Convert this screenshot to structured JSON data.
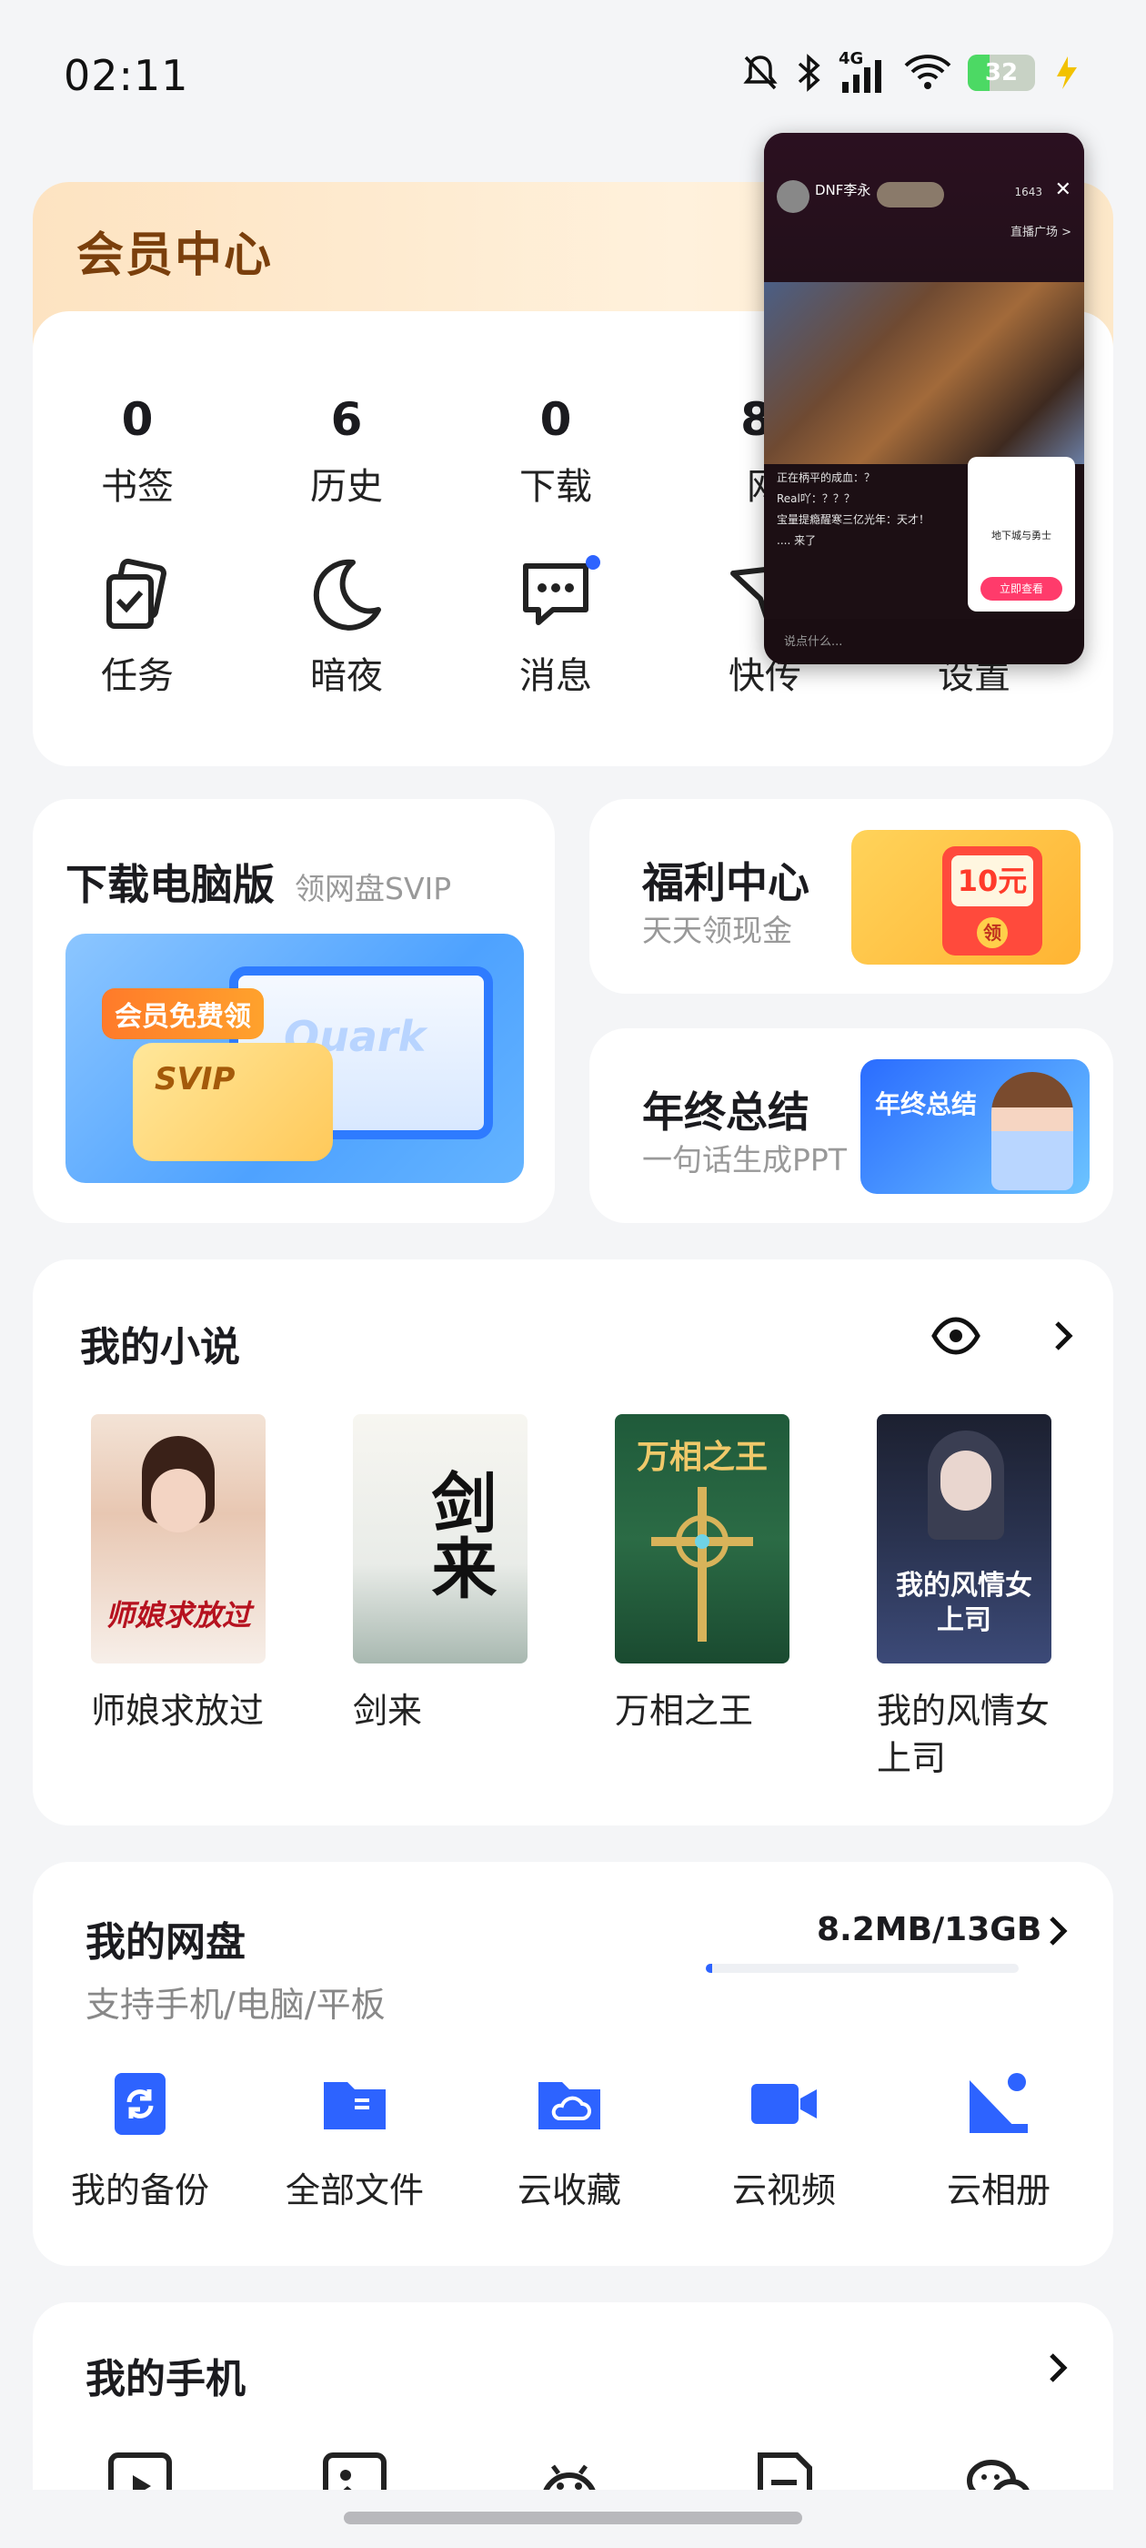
{
  "status_bar": {
    "time": "02:11",
    "network": "4G",
    "battery": "32",
    "battery_level": 0.32
  },
  "member": {
    "title": "会员中心",
    "stats": [
      {
        "value": "0",
        "label": "书签"
      },
      {
        "value": "6",
        "label": "历史"
      },
      {
        "value": "0",
        "label": "下载"
      },
      {
        "value": "8.",
        "label": "网"
      }
    ],
    "tools": [
      {
        "label": "任务",
        "icon": "task-icon"
      },
      {
        "label": "暗夜",
        "icon": "moon-icon"
      },
      {
        "label": "消息",
        "icon": "message-icon"
      },
      {
        "label": "快传",
        "icon": "send-icon"
      },
      {
        "label": "设置",
        "icon": "gear-icon"
      }
    ]
  },
  "floating_video": {
    "streamer": "DNF李永",
    "viewer_count": "1643",
    "plaza_link": "直播广场 >",
    "chat": [
      "正在柄平的成血：？",
      "Real吖：？？？",
      "宝量提瘾醒寒三亿光年：天才！",
      ".... 来了"
    ],
    "ad_title": "地下城与勇士",
    "ad_button": "立即查看",
    "input_placeholder": "说点什么..."
  },
  "download_card": {
    "title": "下载电脑版",
    "subtitle": "领网盘SVIP",
    "tag": "会员免费领",
    "svip": "SVIP",
    "brand": "Quark"
  },
  "welfare_card": {
    "title": "福利中心",
    "subtitle": "天天领现金",
    "amount": "10元",
    "redpack_label": "领"
  },
  "annual_card": {
    "title": "年终总结",
    "subtitle": "一句话生成PPT",
    "art_label": "年终总结"
  },
  "novels": {
    "title": "我的小说",
    "books": [
      {
        "name": "师娘求放过",
        "cover_text": "师娘求放过"
      },
      {
        "name": "剑来",
        "cover_text": "剑来"
      },
      {
        "name": "万相之王",
        "cover_text": "万相之王"
      },
      {
        "name": "我的风情女上司",
        "cover_text": "我的风情女上司"
      }
    ]
  },
  "disk": {
    "title": "我的网盘",
    "subtitle": "支持手机/电脑/平板",
    "usage": "8.2MB/13GB",
    "usage_fraction": 0.02,
    "items": [
      {
        "label": "我的备份",
        "icon": "backup-icon"
      },
      {
        "label": "全部文件",
        "icon": "folder-icon"
      },
      {
        "label": "云收藏",
        "icon": "cloud-folder-icon"
      },
      {
        "label": "云视频",
        "icon": "video-camera-icon"
      },
      {
        "label": "云相册",
        "icon": "album-icon"
      }
    ]
  },
  "phone": {
    "title": "我的手机",
    "items": [
      {
        "icon": "video-file-icon"
      },
      {
        "icon": "image-icon"
      },
      {
        "icon": "android-icon"
      },
      {
        "icon": "document-icon"
      },
      {
        "icon": "wechat-icon"
      }
    ]
  },
  "colors": {
    "accent": "#2d63ff",
    "member_title": "#7a3f0c",
    "background": "#f4f5f7"
  }
}
